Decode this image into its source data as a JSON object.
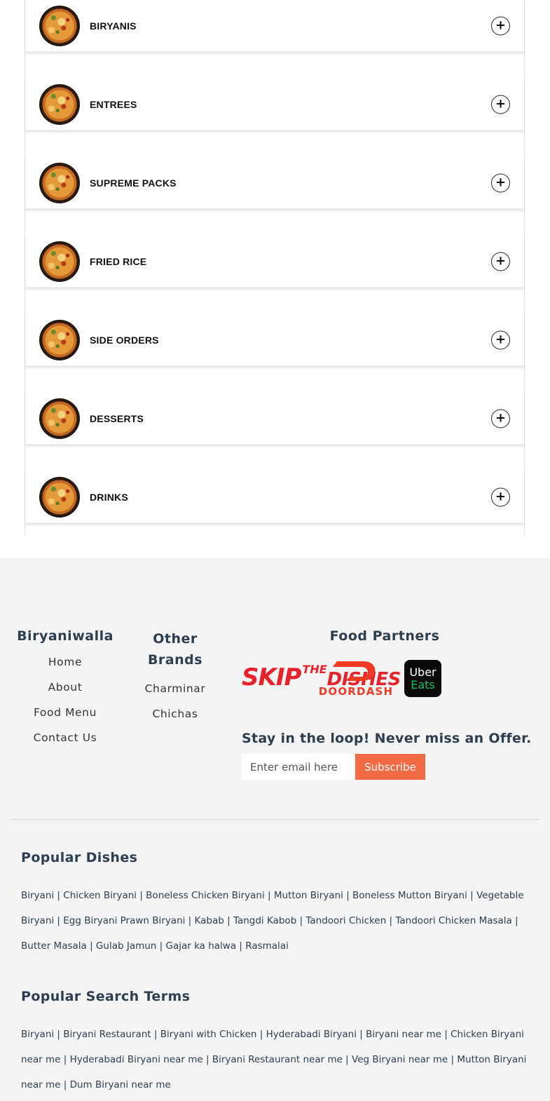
{
  "menu": {
    "categories": [
      {
        "label": "BIRYANIS"
      },
      {
        "label": "ENTREES"
      },
      {
        "label": "SUPREME PACKS"
      },
      {
        "label": "FRIED RICE"
      },
      {
        "label": "SIDE ORDERS"
      },
      {
        "label": "DESSERTS"
      },
      {
        "label": "DRINKS"
      }
    ],
    "toggle_glyph": "+"
  },
  "footer": {
    "col1": {
      "title": "Biryaniwalla",
      "links": [
        "Home",
        "About",
        "Food Menu",
        "Contact Us"
      ]
    },
    "col2": {
      "title": "Other Brands",
      "links": [
        "Charminar",
        "Chichas"
      ]
    },
    "partners": {
      "title": "Food Partners",
      "skip_main": "SKIP",
      "skip_the": "THE",
      "skip_dishes": "DISHES",
      "doordash": "DOORDASH",
      "uber_line1": "Uber",
      "uber_line2": "Eats"
    },
    "newsletter": {
      "title": "Stay in the loop! Never miss an Offer.",
      "placeholder": "Enter email here",
      "button": "Subscribe"
    },
    "popular_dishes": {
      "title": "Popular Dishes",
      "text": "Biryani | Chicken Biryani | Boneless Chicken Biryani | Mutton Biryani | Boneless Mutton Biryani | Vegetable Biryani | Egg Biryani Prawn Biryani | Kabab | Tangdi Kabob | Tandoori Chicken | Tandoori Chicken Masala | Butter Masala | Gulab Jamun | Gajar ka halwa | Rasmalai"
    },
    "popular_search": {
      "title": "Popular Search Terms",
      "text": "Biryani | Biryani Restaurant | Biryani with Chicken | Hyderabadi Biryani | Biryani near me | Chicken Biryani near me | Hyderabadi Biryani near me | Biryani Restaurant near me | Veg Biryani near me | Mutton Biryani near me | Dum Biryani near me"
    }
  },
  "colors": {
    "accent": "#f26b45",
    "heading": "#2c3e50",
    "footer_bg": "#f4f4f4",
    "skip_red": "#e8222a",
    "doordash_red": "#ef3a25",
    "uber_green": "#06c167"
  }
}
